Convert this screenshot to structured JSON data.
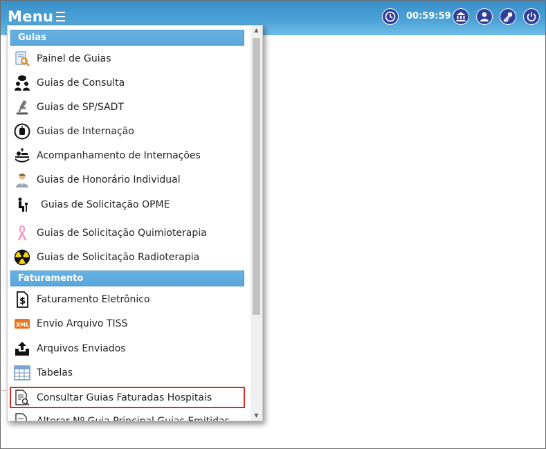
{
  "header": {
    "menu_label": "Menu",
    "timer": "00:59:59",
    "icons": [
      "clock-icon",
      "bank-icon",
      "user-icon",
      "key-icon",
      "power-icon"
    ]
  },
  "menu": {
    "sections": [
      {
        "title": "Guias",
        "items": [
          {
            "label": "Painel de Guias",
            "icon": "panel-search-icon"
          },
          {
            "label": "Guias de Consulta",
            "icon": "people-chat-icon"
          },
          {
            "label": "Guias de SP/SADT",
            "icon": "microscope-icon"
          },
          {
            "label": "Guias de Internação",
            "icon": "blood-bag-icon"
          },
          {
            "label": "Acompanhamento de Internações",
            "icon": "patient-bed-icon"
          },
          {
            "label": "Guias de Honorário Individual",
            "icon": "doctor-icon"
          },
          {
            "label": "Guias de Solicitação OPME",
            "icon": "person-seated-icon"
          },
          {
            "label": "Guias de Solicitação Quimioterapia",
            "icon": "pink-ribbon-icon"
          },
          {
            "label": "Guias de Solicitação Radioterapia",
            "icon": "radiation-icon"
          }
        ]
      },
      {
        "title": "Faturamento",
        "items": [
          {
            "label": "Faturamento Eletrônico",
            "icon": "dollar-document-icon"
          },
          {
            "label": "Envio Arquivo TISS",
            "icon": "xml-file-icon"
          },
          {
            "label": "Arquivos Enviados",
            "icon": "upload-tray-icon"
          },
          {
            "label": "Tabelas",
            "icon": "table-icon"
          },
          {
            "label": "Consultar Guias Faturadas Hospitais",
            "icon": "document-search-icon"
          },
          {
            "label": "Alterar Nº Guia Principal Guias Emitidas",
            "icon": "document-edit-icon"
          }
        ]
      }
    ],
    "xml_badge": "XML"
  },
  "colors": {
    "header_blue": "#4aa1d6",
    "icon_circle": "#2f3f9a",
    "highlight_red": "#d42a2a"
  }
}
